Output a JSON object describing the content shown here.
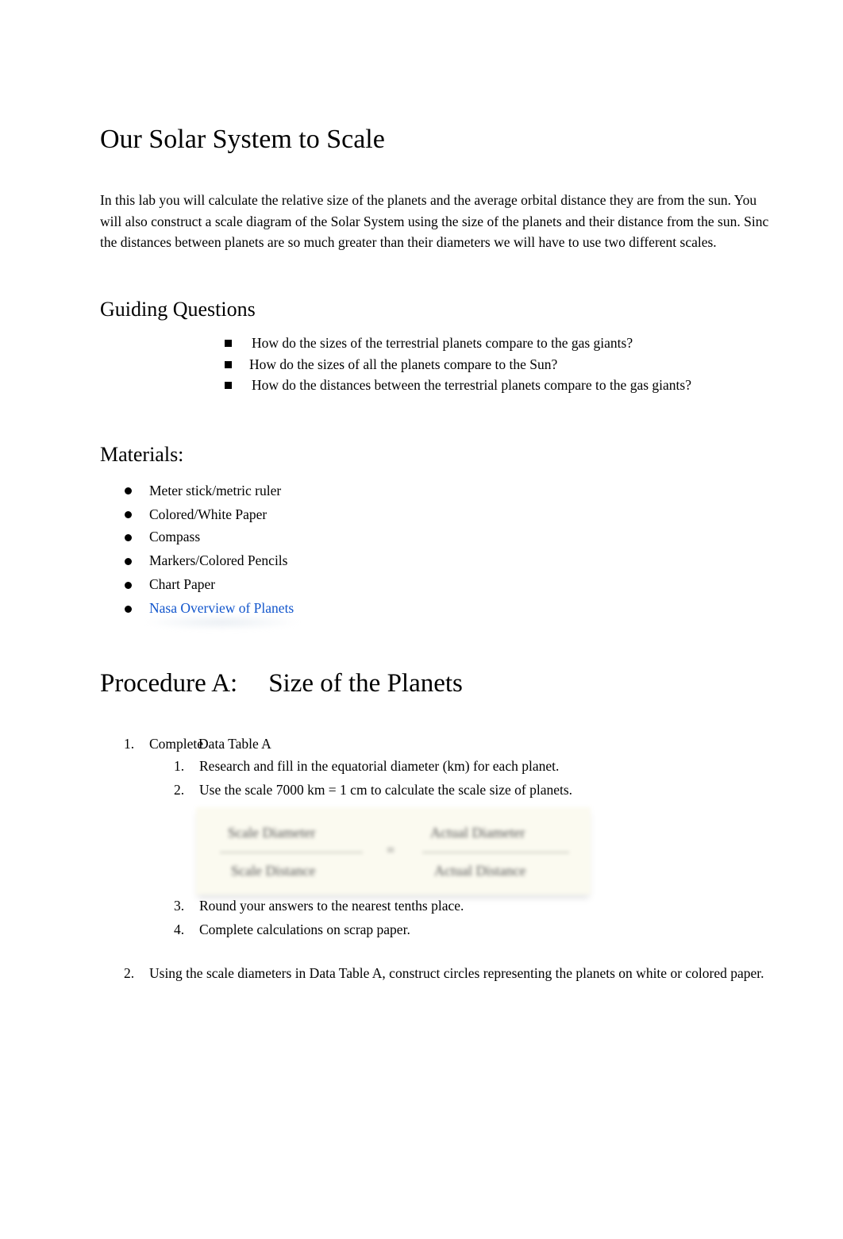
{
  "title": "Our Solar System to Scale",
  "intro_lines": [
    "In this lab you will calculate the relative size of the planets and the average orbital distance they are from the sun. You",
    "will also construct a scale diagram of the Solar System using the size of the planets and their distance from the sun. Sinc",
    "the distances between planets are so much greater than their diameters we will have to use two different scales."
  ],
  "guiding": {
    "heading": "Guiding Questions",
    "questions": [
      "How do the sizes of the terrestrial planets compare to the gas giants?",
      "How do the sizes of all the planets compare to the Sun?",
      "How do the distances between the terrestrial planets compare to the gas giants?"
    ]
  },
  "materials": {
    "heading": "Materials:",
    "items": [
      "Meter stick/metric ruler",
      "Colored/White Paper",
      "Compass",
      "Markers/Colored Pencils",
      "Chart Paper"
    ],
    "link_label": "Nasa Overview of Planets",
    "link_color": "#1155cc"
  },
  "procedure": {
    "heading_left": "Procedure A:",
    "heading_right": "Size of the Planets",
    "step1": {
      "num": "1.",
      "label_a": "Complete",
      "label_b": "Data Table A",
      "substeps": [
        {
          "num": "1.",
          "text": "Research and fill in the equatorial diameter (km) for each planet."
        },
        {
          "num": "2.",
          "text": "Use the scale 7000 km = 1 cm to calculate the scale size of planets."
        },
        {
          "num": "3.",
          "text": "Round your answers to the nearest tenths place."
        },
        {
          "num": "4.",
          "text": "Complete calculations on scrap paper."
        }
      ]
    },
    "formula": {
      "left_num": "Scale Diameter",
      "left_den": "Scale Distance",
      "op": "=",
      "right_num": "Actual Diameter",
      "right_den": "Actual Distance"
    },
    "step2": {
      "num": "2.",
      "text": "Using the scale diameters in Data Table A, construct circles representing the planets on white or colored paper."
    }
  }
}
